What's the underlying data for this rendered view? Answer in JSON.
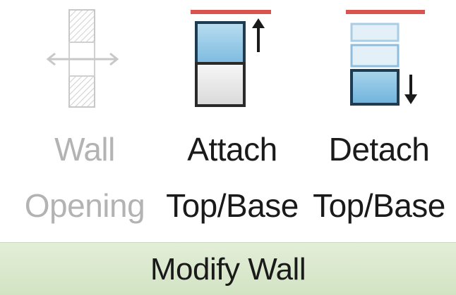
{
  "ribbon_panel": {
    "title": "Modify Wall",
    "tools": [
      {
        "line1": "Wall",
        "line2": "Opening",
        "enabled": false,
        "icon": "wall-opening-icon"
      },
      {
        "line1": "Attach",
        "line2": "Top/Base",
        "enabled": true,
        "icon": "attach-top-base-icon"
      },
      {
        "line1": "Detach",
        "line2": "Top/Base",
        "enabled": true,
        "icon": "detach-top-base-icon"
      }
    ]
  },
  "colors": {
    "accent_red": "#d9534f",
    "wall_blue": "#7fc0e0",
    "wall_outline": "#1f5f8b",
    "disabled_gray": "#b3b3b3",
    "footer_green": "#d9e8cb"
  }
}
